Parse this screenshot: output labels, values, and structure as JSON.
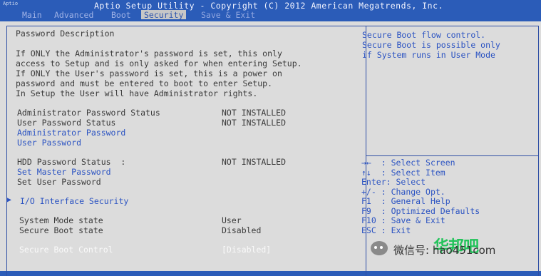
{
  "header": {
    "logo_text": "Aptio",
    "title": "Aptio Setup Utility - Copyright (C) 2012 American Megatrends, Inc."
  },
  "tabs": [
    {
      "label": "Main"
    },
    {
      "label": "Advanced"
    },
    {
      "label": "Boot"
    },
    {
      "label": "Security"
    },
    {
      "label": "Save & Exit"
    }
  ],
  "main": {
    "section_title": "Password Description",
    "description": [
      "If ONLY the Administrator's password is set, this only",
      "access to Setup and is only asked for when entering Setup.",
      "If ONLY the User's password is set, this is a power on",
      "password and must be entered to boot to enter Setup.",
      "In Setup the User will have Administrator rights."
    ],
    "admin_status_label": "Administrator Password Status",
    "admin_status_value": "NOT INSTALLED",
    "user_status_label": "User Password Status",
    "user_status_value": "NOT INSTALLED",
    "admin_password_link": "Administrator Password",
    "user_password_link": "User Password",
    "hdd_status_label": "HDD Password Status  :",
    "hdd_status_value": "NOT INSTALLED",
    "set_master_password": "Set Master Password",
    "set_user_password": "Set User Password",
    "io_interface_security": "I/O Interface Security",
    "system_mode_label": "System Mode state",
    "system_mode_value": "User",
    "secure_boot_state_label": "Secure Boot state",
    "secure_boot_state_value": "Disabled",
    "secure_boot_control_label": "Secure Boot Control",
    "secure_boot_control_value": "[Disabled]"
  },
  "help": {
    "lines": [
      "Secure Boot flow control.",
      "Secure Boot is possible only",
      "if System runs in User Mode"
    ]
  },
  "keys": [
    {
      "key": "→←",
      "desc": ": Select Screen"
    },
    {
      "key": "↑↓",
      "desc": ": Select Item"
    },
    {
      "key": "Enter",
      "desc": ": Select"
    },
    {
      "key": "+/-",
      "desc": ": Change Opt."
    },
    {
      "key": "F1",
      "desc": ": General Help"
    },
    {
      "key": "F9",
      "desc": ": Optimized Defaults"
    },
    {
      "key": "F10",
      "desc": ": Save & Exit"
    },
    {
      "key": "ESC",
      "desc": ": Exit"
    }
  ],
  "watermark": {
    "text": "微信号: hao451com",
    "green_text": "华邦吧"
  }
}
